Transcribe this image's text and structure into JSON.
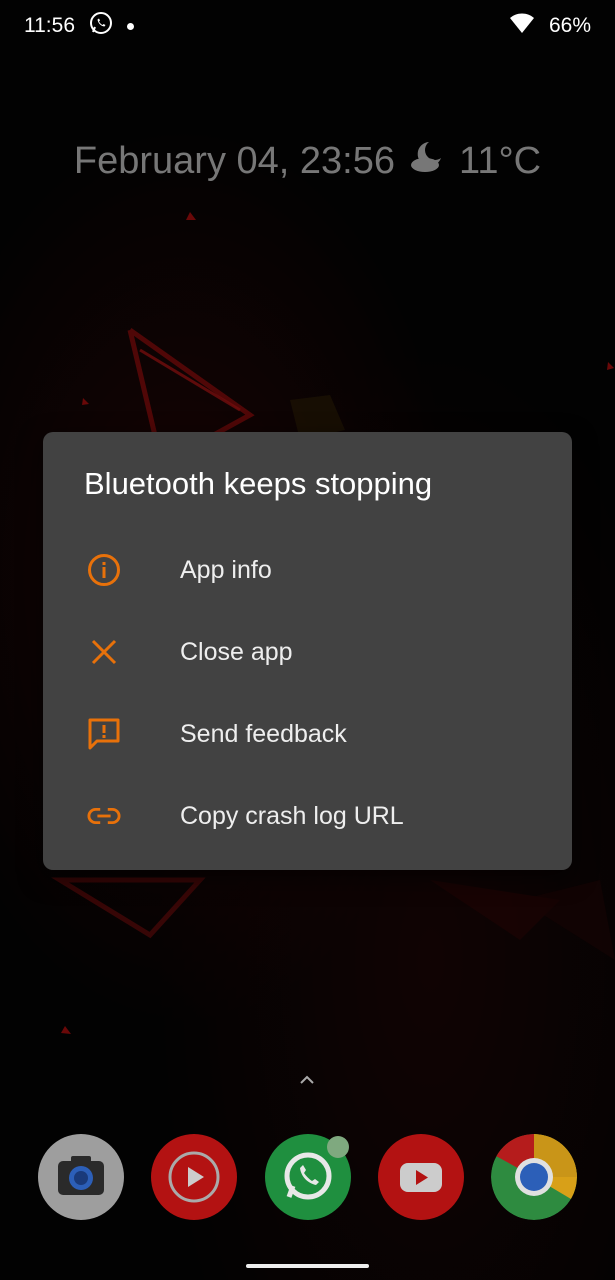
{
  "status_bar": {
    "time": "11:56",
    "battery": "66%",
    "notification_icons": [
      "whatsapp-icon",
      "dot-icon"
    ],
    "system_icons": [
      "wifi-icon"
    ]
  },
  "glance": {
    "date_time": "February 04, 23:56",
    "weather_icon": "moon-cloud-icon",
    "temperature": "11°C"
  },
  "dialog": {
    "title": "Bluetooth keeps stopping",
    "accent_color": "#e8710a",
    "items": [
      {
        "icon": "info-icon",
        "label": "App info"
      },
      {
        "icon": "close-icon",
        "label": "Close app"
      },
      {
        "icon": "feedback-icon",
        "label": "Send feedback"
      },
      {
        "icon": "link-icon",
        "label": "Copy crash log URL"
      }
    ]
  },
  "dock": {
    "apps": [
      {
        "name": "camera",
        "icon": "camera-app-icon"
      },
      {
        "name": "youtube-music",
        "icon": "youtube-music-app-icon"
      },
      {
        "name": "whatsapp",
        "icon": "whatsapp-app-icon"
      },
      {
        "name": "youtube",
        "icon": "youtube-app-icon"
      },
      {
        "name": "chrome",
        "icon": "chrome-app-icon"
      }
    ]
  }
}
